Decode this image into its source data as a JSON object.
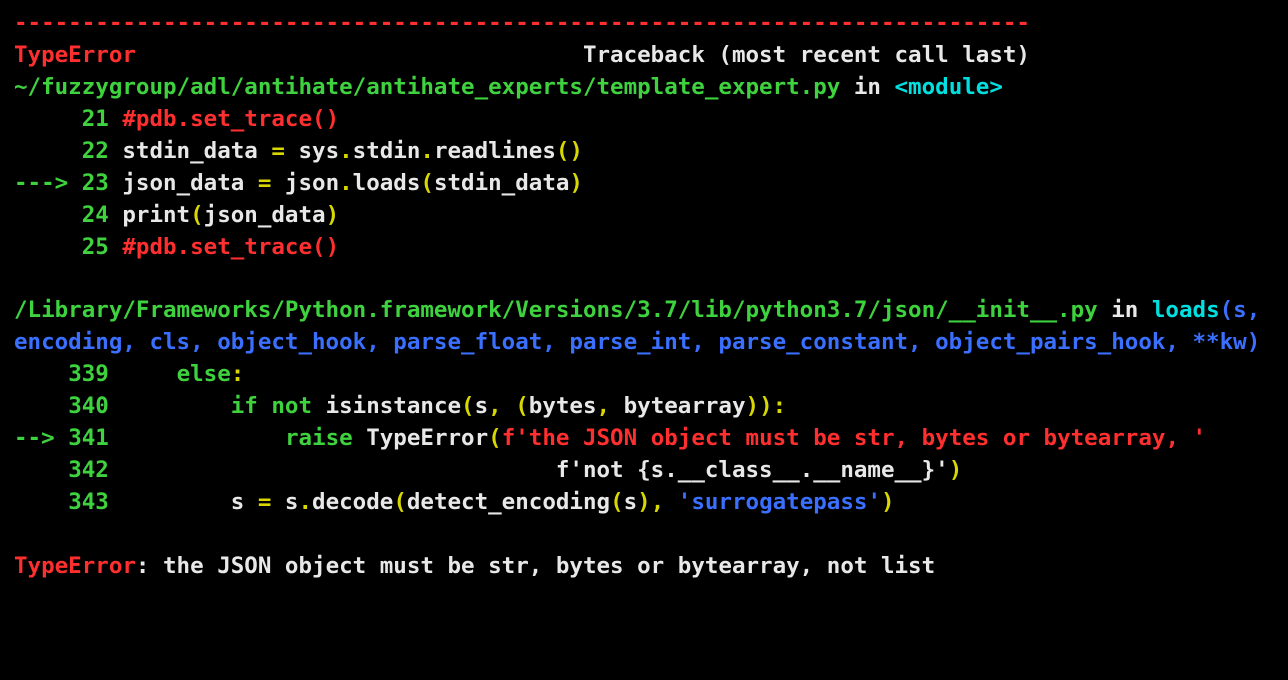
{
  "divider": "---------------------------------------------------------------------------",
  "exc_header": {
    "name": "TypeError",
    "spacer": "                                 ",
    "right": "Traceback (most recent call last)"
  },
  "frame1": {
    "path": "~/fuzzygroup/adl/antihate/antihate_experts/template_expert.py",
    "in": " in ",
    "module": "<module>",
    "lines": [
      {
        "num": "21",
        "prefix": "     ",
        "content_plain": " #pdb.set_trace()"
      },
      {
        "num": "22",
        "prefix": "     "
      },
      {
        "num": "23",
        "prefix": "---> "
      },
      {
        "num": "24",
        "prefix": "     "
      },
      {
        "num": "25",
        "prefix": "     ",
        "content_plain": " #pdb.set_trace()"
      }
    ],
    "l22": {
      "a": " stdin_data ",
      "b": "=",
      "c": " sys",
      "d": ".",
      "e": "stdin",
      "f": ".",
      "g": "readlines",
      "h": "()"
    },
    "l23": {
      "a": " json_data ",
      "b": "=",
      "c": " json",
      "d": ".",
      "e": "loads",
      "f": "(",
      "g": "stdin_data",
      "h": ")"
    },
    "l24": {
      "a": " ",
      "b": "print",
      "c": "(",
      "d": "json_data",
      "e": ")"
    }
  },
  "frame2": {
    "path": "/Library/Frameworks/Python.framework/Versions/3.7/lib/python3.7/json/__init__.py",
    "in": " in ",
    "func": "loads",
    "sig": "(s, encoding, cls, object_hook, parse_float, parse_int, parse_constant, object_pairs_hook, **kw)",
    "lines": {
      "339": {
        "prefix": "    ",
        "num": "339",
        "indent": "     ",
        "kw": "else",
        "colon": ":"
      },
      "340": {
        "prefix": "    ",
        "num": "340",
        "indent": "         ",
        "a": "if",
        "b": " ",
        "c": "not",
        "d": " isinstance",
        "e": "(",
        "f": "s",
        "g": ",",
        "h": " ",
        "i": "(",
        "j": "bytes",
        "k": ",",
        "l": " bytearray",
        "m": "))",
        "n": ":"
      },
      "341": {
        "prefix": "--> ",
        "num": "341",
        "indent": "             ",
        "a": "raise",
        "b": " TypeError",
        "c": "(",
        "d": "f'the JSON object must be str, bytes or bytearray, '"
      },
      "342": {
        "prefix": "    ",
        "num": "342",
        "indent": "                                 ",
        "a": "f'not {s.__class__.__name__}'",
        "b": ")"
      },
      "343": {
        "prefix": "    ",
        "num": "343",
        "indent": "         ",
        "a": "s ",
        "b": "=",
        "c": " s",
        "d": ".",
        "e": "decode",
        "f": "(",
        "g": "detect_encoding",
        "h": "(",
        "i": "s",
        "j": "),",
        "k": " ",
        "l": "'surrogatepass'",
        "m": ")"
      }
    }
  },
  "final": {
    "name": "TypeError",
    "sep": ": ",
    "msg": "the JSON object must be str, bytes or bytearray, not list"
  }
}
